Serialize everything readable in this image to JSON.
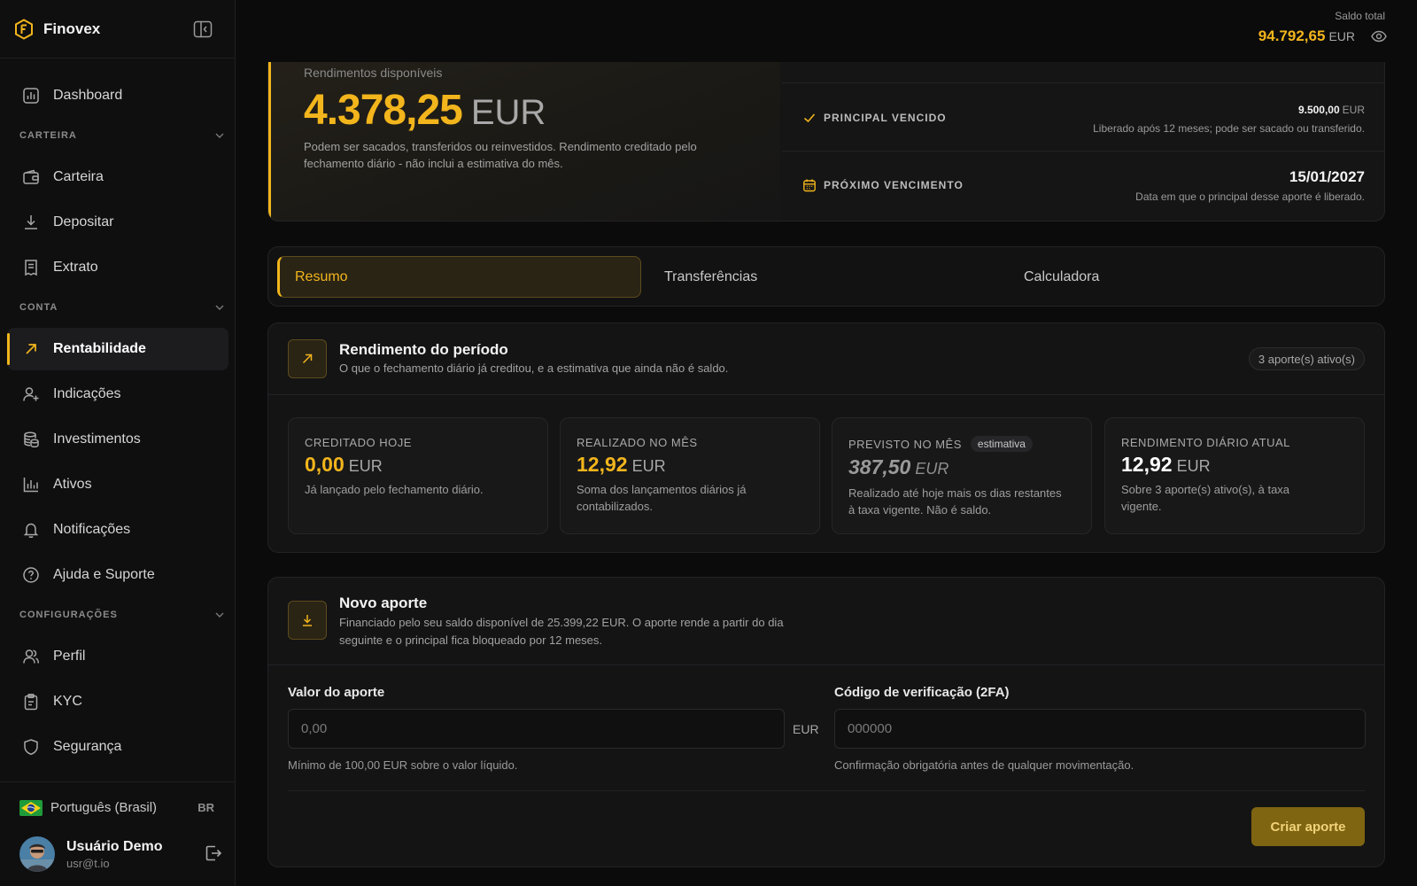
{
  "app": {
    "name": "Finovex"
  },
  "sidebar": {
    "dashboard": "Dashboard",
    "sections": {
      "carteira": "CARTEIRA",
      "conta": "CONTA",
      "configuracoes": "CONFIGURAÇÕES"
    },
    "items": {
      "carteira": "Carteira",
      "depositar": "Depositar",
      "extrato": "Extrato",
      "rentabilidade": "Rentabilidade",
      "indicacoes": "Indicações",
      "investimentos": "Investimentos",
      "ativos": "Ativos",
      "notificacoes": "Notificações",
      "ajuda": "Ajuda e Suporte",
      "perfil": "Perfil",
      "kyc": "KYC",
      "seguranca": "Segurança"
    },
    "active_item": "rentabilidade",
    "language": {
      "label": "Português (Brasil)",
      "code": "BR"
    },
    "user": {
      "name": "Usuário Demo",
      "email": "usr@t.io"
    }
  },
  "topbar": {
    "balance_label": "Saldo total",
    "balance_value": "94.792,65",
    "balance_currency": "EUR"
  },
  "hero": {
    "subtitle": "Rendimentos disponíveis",
    "value": "4.378,25",
    "currency": "EUR",
    "description": "Podem ser sacados, transferidos ou reinvestidos. Rendimento creditado pelo fechamento diário - não inclui a estimativa do mês.",
    "principal": {
      "title": "PRINCIPAL VENCIDO",
      "value": "9.500,00",
      "currency": "EUR",
      "note": "Liberado após 12 meses; pode ser sacado ou transferido."
    },
    "next_maturity": {
      "title": "PRÓXIMO VENCIMENTO",
      "date": "15/01/2027",
      "note": "Data em que o principal desse aporte é liberado."
    }
  },
  "tabs": {
    "resumo": "Resumo",
    "transferencias": "Transferências",
    "calculadora": "Calculadora",
    "active": "resumo"
  },
  "period": {
    "title": "Rendimento do período",
    "subtitle": "O que o fechamento diário já creditou, e a estimativa que ainda não é saldo.",
    "badge": "3 aporte(s) ativo(s)",
    "stats": {
      "today": {
        "label": "CREDITADO HOJE",
        "value": "0,00",
        "currency": "EUR",
        "desc": "Já lançado pelo fechamento diário."
      },
      "month": {
        "label": "REALIZADO NO MÊS",
        "value": "12,92",
        "currency": "EUR",
        "desc": "Soma dos lançamentos diários já contabilizados."
      },
      "forecast": {
        "label": "PREVISTO NO MÊS",
        "tag": "estimativa",
        "value": "387,50",
        "currency": "EUR",
        "desc": "Realizado até hoje mais os dias restantes à taxa vigente. Não é saldo."
      },
      "daily": {
        "label": "RENDIMENTO DIÁRIO ATUAL",
        "value": "12,92",
        "currency": "EUR",
        "desc": "Sobre 3 aporte(s) ativo(s), à taxa vigente."
      }
    }
  },
  "new_contribution": {
    "title": "Novo aporte",
    "subtitle": "Financiado pelo seu saldo disponível de 25.399,22 EUR. O aporte rende a partir do dia seguinte e o principal fica bloqueado por 12 meses.",
    "amount": {
      "label": "Valor do aporte",
      "placeholder": "0,00",
      "suffix": "EUR",
      "hint": "Mínimo de 100,00 EUR sobre o valor líquido."
    },
    "code": {
      "label": "Código de verificação (2FA)",
      "placeholder": "000000",
      "hint": "Confirmação obrigatória antes de qualquer movimentação."
    },
    "submit": "Criar aporte"
  },
  "colors": {
    "accent": "#f2b51c",
    "background": "#0b0b0c",
    "card": "#141415"
  }
}
